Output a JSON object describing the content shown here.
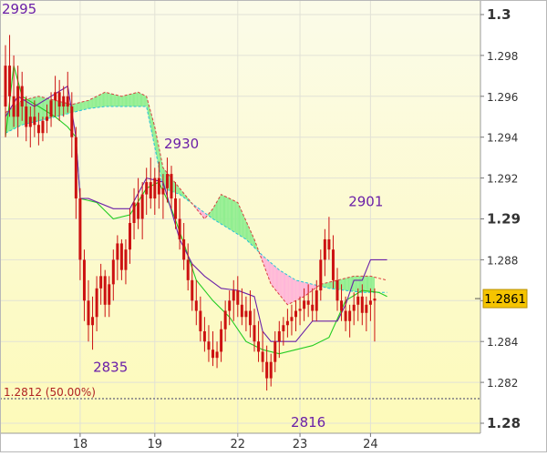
{
  "chart_data": {
    "type": "candlestick",
    "background": {
      "top": "#fbfbe9",
      "bottom": "#fdfab9"
    },
    "grid": true,
    "x_ticks": [
      {
        "label": "18",
        "index": 18
      },
      {
        "label": "19",
        "index": 36
      },
      {
        "label": "22",
        "index": 56
      },
      {
        "label": "23",
        "index": 71
      },
      {
        "label": "24",
        "index": 88
      }
    ],
    "y_axis": {
      "min": 1.28,
      "max": 1.3,
      "ticks": [
        {
          "value": 1.3,
          "label": "1.3",
          "major": true
        },
        {
          "value": 1.298,
          "label": "1.298",
          "major": false
        },
        {
          "value": 1.296,
          "label": "1.296",
          "major": false
        },
        {
          "value": 1.294,
          "label": "1.294",
          "major": false
        },
        {
          "value": 1.292,
          "label": "1.292",
          "major": false
        },
        {
          "value": 1.29,
          "label": "1.29",
          "major": true
        },
        {
          "value": 1.288,
          "label": "1.288",
          "major": false
        },
        {
          "value": 1.286,
          "label": "1.286",
          "major": false
        },
        {
          "value": 1.284,
          "label": "1.284",
          "major": false
        },
        {
          "value": 1.282,
          "label": "1.282",
          "major": false
        },
        {
          "value": 1.28,
          "label": "1.28",
          "major": true
        }
      ]
    },
    "current_price": {
      "value": 1.2861,
      "label": "1.2861",
      "color": "#f5c400"
    },
    "reference_line": {
      "value": 1.2812,
      "label": "1.2812 (50.00%)"
    },
    "annotations": [
      {
        "label": "2995",
        "index": 0,
        "value": 1.2995
      },
      {
        "label": "2930",
        "index": 40,
        "value": 1.293
      },
      {
        "label": "2835",
        "index": 22,
        "value": 1.2835
      },
      {
        "label": "2901",
        "index": 84,
        "value": 1.2901
      },
      {
        "label": "2816",
        "index": 71,
        "value": 1.2816
      }
    ],
    "colors": {
      "candle": "#cc1111",
      "tenkan": "#6b21a8",
      "kijun": "#22cc22",
      "cloud_bull": "#90ee90",
      "cloud_bear": "#ffb6d9",
      "span_a_line": "#22c3d8",
      "span_b_line": "#d84040",
      "annotation": "#6b1fa8"
    },
    "ohlc": [
      [
        1.2955,
        1.2985,
        1.294,
        1.2975
      ],
      [
        1.2975,
        1.299,
        1.295,
        1.296
      ],
      [
        1.296,
        1.298,
        1.2945,
        1.295
      ],
      [
        1.295,
        1.2975,
        1.294,
        1.2965
      ],
      [
        1.2965,
        1.2972,
        1.2948,
        1.2955
      ],
      [
        1.2955,
        1.296,
        1.2938,
        1.2945
      ],
      [
        1.2945,
        1.2955,
        1.2935,
        1.295
      ],
      [
        1.295,
        1.2958,
        1.294,
        1.2946
      ],
      [
        1.2946,
        1.2952,
        1.2936,
        1.2942
      ],
      [
        1.2942,
        1.295,
        1.2938,
        1.2948
      ],
      [
        1.2948,
        1.2956,
        1.2942,
        1.295
      ],
      [
        1.295,
        1.2962,
        1.2945,
        1.2958
      ],
      [
        1.2958,
        1.297,
        1.295,
        1.2962
      ],
      [
        1.2962,
        1.2968,
        1.2948,
        1.2955
      ],
      [
        1.2955,
        1.2965,
        1.295,
        1.296
      ],
      [
        1.296,
        1.2972,
        1.2952,
        1.2955
      ],
      [
        1.2955,
        1.2962,
        1.293,
        1.294
      ],
      [
        1.294,
        1.2945,
        1.29,
        1.291
      ],
      [
        1.291,
        1.2915,
        1.287,
        1.288
      ],
      [
        1.288,
        1.2885,
        1.285,
        1.286
      ],
      [
        1.286,
        1.287,
        1.284,
        1.2848
      ],
      [
        1.2848,
        1.2862,
        1.2836,
        1.2852
      ],
      [
        1.2852,
        1.2872,
        1.2845,
        1.2866
      ],
      [
        1.2866,
        1.2878,
        1.2858,
        1.2872
      ],
      [
        1.2872,
        1.2875,
        1.2852,
        1.2858
      ],
      [
        1.2858,
        1.2872,
        1.2852,
        1.2868
      ],
      [
        1.2868,
        1.2885,
        1.286,
        1.288
      ],
      [
        1.288,
        1.2892,
        1.287,
        1.2888
      ],
      [
        1.2888,
        1.289,
        1.287,
        1.2875
      ],
      [
        1.2875,
        1.289,
        1.2868,
        1.2885
      ],
      [
        1.2885,
        1.2905,
        1.2878,
        1.2898
      ],
      [
        1.2898,
        1.2915,
        1.289,
        1.2908
      ],
      [
        1.2908,
        1.292,
        1.2895,
        1.29
      ],
      [
        1.29,
        1.2918,
        1.289,
        1.2912
      ],
      [
        1.2912,
        1.2925,
        1.2902,
        1.2918
      ],
      [
        1.2918,
        1.293,
        1.2905,
        1.291
      ],
      [
        1.291,
        1.2925,
        1.2902,
        1.292
      ],
      [
        1.292,
        1.2928,
        1.2905,
        1.2912
      ],
      [
        1.2912,
        1.2922,
        1.29,
        1.2915
      ],
      [
        1.2915,
        1.293,
        1.2908,
        1.2922
      ],
      [
        1.2922,
        1.2926,
        1.2905,
        1.291
      ],
      [
        1.291,
        1.2918,
        1.2895,
        1.29
      ],
      [
        1.29,
        1.291,
        1.2885,
        1.289
      ],
      [
        1.289,
        1.2898,
        1.2875,
        1.288
      ],
      [
        1.288,
        1.2888,
        1.2865,
        1.287
      ],
      [
        1.287,
        1.2878,
        1.2855,
        1.286
      ],
      [
        1.286,
        1.287,
        1.2848,
        1.2855
      ],
      [
        1.2855,
        1.2862,
        1.284,
        1.2845
      ],
      [
        1.2845,
        1.2852,
        1.2835,
        1.284
      ],
      [
        1.284,
        1.2848,
        1.283,
        1.2836
      ],
      [
        1.2836,
        1.2845,
        1.2828,
        1.2832
      ],
      [
        1.2832,
        1.284,
        1.2827,
        1.2835
      ],
      [
        1.2835,
        1.285,
        1.283,
        1.2846
      ],
      [
        1.2846,
        1.286,
        1.284,
        1.2855
      ],
      [
        1.2855,
        1.2865,
        1.2848,
        1.286
      ],
      [
        1.286,
        1.287,
        1.285,
        1.2865
      ],
      [
        1.2865,
        1.2872,
        1.2852,
        1.2858
      ],
      [
        1.2858,
        1.2866,
        1.2848,
        1.2852
      ],
      [
        1.2852,
        1.2862,
        1.2845,
        1.2855
      ],
      [
        1.2855,
        1.2865,
        1.2842,
        1.2848
      ],
      [
        1.2848,
        1.2856,
        1.2835,
        1.284
      ],
      [
        1.284,
        1.285,
        1.283,
        1.2835
      ],
      [
        1.2835,
        1.2845,
        1.2825,
        1.283
      ],
      [
        1.283,
        1.2838,
        1.2816,
        1.2822
      ],
      [
        1.2822,
        1.2834,
        1.2818,
        1.283
      ],
      [
        1.283,
        1.2845,
        1.2825,
        1.284
      ],
      [
        1.284,
        1.285,
        1.2832,
        1.2845
      ],
      [
        1.2845,
        1.2852,
        1.2838,
        1.2848
      ],
      [
        1.2848,
        1.2856,
        1.2842,
        1.285
      ],
      [
        1.285,
        1.2858,
        1.2843,
        1.2852
      ],
      [
        1.2852,
        1.286,
        1.2845,
        1.2855
      ],
      [
        1.2855,
        1.2862,
        1.2848,
        1.2856
      ],
      [
        1.2856,
        1.2866,
        1.285,
        1.286
      ],
      [
        1.286,
        1.2868,
        1.2852,
        1.2858
      ],
      [
        1.2858,
        1.2866,
        1.285,
        1.2855
      ],
      [
        1.2855,
        1.287,
        1.285,
        1.2865
      ],
      [
        1.2865,
        1.2885,
        1.286,
        1.288
      ],
      [
        1.288,
        1.2895,
        1.2872,
        1.289
      ],
      [
        1.289,
        1.2901,
        1.288,
        1.2885
      ],
      [
        1.2885,
        1.2892,
        1.2866,
        1.287
      ],
      [
        1.287,
        1.2876,
        1.2855,
        1.286
      ],
      [
        1.286,
        1.2868,
        1.285,
        1.2855
      ],
      [
        1.2855,
        1.2862,
        1.2845,
        1.285
      ],
      [
        1.285,
        1.2858,
        1.2842,
        1.2855
      ],
      [
        1.2855,
        1.2864,
        1.2848,
        1.2858
      ],
      [
        1.2858,
        1.2866,
        1.285,
        1.2862
      ],
      [
        1.2862,
        1.2868,
        1.2848,
        1.2854
      ],
      [
        1.2854,
        1.2862,
        1.2845,
        1.2858
      ],
      [
        1.2858,
        1.2866,
        1.285,
        1.286
      ],
      [
        1.286,
        1.2866,
        1.284,
        1.2861
      ]
    ],
    "tenkan": [
      [
        0,
        1.295
      ],
      [
        3,
        1.296
      ],
      [
        7,
        1.2955
      ],
      [
        11,
        1.296
      ],
      [
        15,
        1.2965
      ],
      [
        17,
        1.294
      ],
      [
        18,
        1.291
      ],
      [
        20,
        1.291
      ],
      [
        26,
        1.2905
      ],
      [
        27,
        1.2905
      ],
      [
        30,
        1.2905
      ],
      [
        34,
        1.292
      ],
      [
        38,
        1.2918
      ],
      [
        42,
        1.289
      ],
      [
        45,
        1.2878
      ],
      [
        48,
        1.2872
      ],
      [
        52,
        1.2866
      ],
      [
        56,
        1.2865
      ],
      [
        60,
        1.2862
      ],
      [
        62,
        1.2845
      ],
      [
        64,
        1.284
      ],
      [
        70,
        1.284
      ],
      [
        74,
        1.285
      ],
      [
        80,
        1.285
      ],
      [
        82,
        1.2858
      ],
      [
        84,
        1.287
      ],
      [
        86,
        1.287
      ],
      [
        88,
        1.288
      ],
      [
        92,
        1.288
      ]
    ],
    "kijun": [
      [
        0,
        1.294
      ],
      [
        2,
        1.2975
      ],
      [
        4,
        1.296
      ],
      [
        8,
        1.2955
      ],
      [
        12,
        1.295
      ],
      [
        15,
        1.2945
      ],
      [
        17,
        1.294
      ],
      [
        18,
        1.291
      ],
      [
        22,
        1.2908
      ],
      [
        26,
        1.29
      ],
      [
        30,
        1.2902
      ],
      [
        34,
        1.2915
      ],
      [
        37,
        1.2918
      ],
      [
        40,
        1.2905
      ],
      [
        43,
        1.2888
      ],
      [
        46,
        1.287
      ],
      [
        50,
        1.286
      ],
      [
        54,
        1.2852
      ],
      [
        58,
        1.284
      ],
      [
        62,
        1.2836
      ],
      [
        66,
        1.2834
      ],
      [
        70,
        1.2836
      ],
      [
        74,
        1.2838
      ],
      [
        78,
        1.2842
      ],
      [
        82,
        1.286
      ],
      [
        86,
        1.2865
      ],
      [
        90,
        1.2864
      ],
      [
        92,
        1.2862
      ]
    ],
    "span_a": [
      [
        0,
        1.2942
      ],
      [
        4,
        1.2946
      ],
      [
        8,
        1.2948
      ],
      [
        12,
        1.295
      ],
      [
        16,
        1.2952
      ],
      [
        20,
        1.2954
      ],
      [
        24,
        1.2955
      ],
      [
        28,
        1.2955
      ],
      [
        32,
        1.2955
      ],
      [
        34,
        1.2955
      ],
      [
        36,
        1.2935
      ],
      [
        38,
        1.2915
      ],
      [
        42,
        1.2912
      ],
      [
        46,
        1.2906
      ],
      [
        50,
        1.29
      ],
      [
        54,
        1.2895
      ],
      [
        58,
        1.289
      ],
      [
        62,
        1.2882
      ],
      [
        66,
        1.2875
      ],
      [
        70,
        1.287
      ],
      [
        74,
        1.2868
      ],
      [
        78,
        1.2866
      ],
      [
        82,
        1.2865
      ],
      [
        86,
        1.2864
      ],
      [
        90,
        1.2864
      ],
      [
        92,
        1.2864
      ]
    ],
    "span_b": [
      [
        0,
        1.2952
      ],
      [
        4,
        1.2958
      ],
      [
        8,
        1.296
      ],
      [
        12,
        1.2958
      ],
      [
        16,
        1.2956
      ],
      [
        20,
        1.2958
      ],
      [
        24,
        1.2962
      ],
      [
        28,
        1.296
      ],
      [
        32,
        1.2962
      ],
      [
        34,
        1.296
      ],
      [
        36,
        1.2945
      ],
      [
        38,
        1.2925
      ],
      [
        42,
        1.2915
      ],
      [
        46,
        1.2905
      ],
      [
        48,
        1.29
      ],
      [
        50,
        1.2905
      ],
      [
        52,
        1.2912
      ],
      [
        56,
        1.2908
      ],
      [
        60,
        1.289
      ],
      [
        64,
        1.2868
      ],
      [
        68,
        1.2858
      ],
      [
        72,
        1.2862
      ],
      [
        76,
        1.2868
      ],
      [
        80,
        1.287
      ],
      [
        84,
        1.2872
      ],
      [
        88,
        1.2872
      ],
      [
        92,
        1.287
      ]
    ]
  }
}
